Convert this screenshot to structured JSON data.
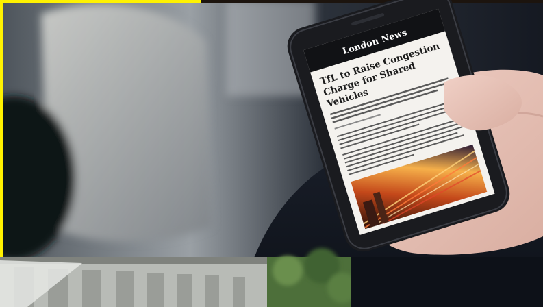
{
  "article": {
    "masthead": "London News",
    "headline_lines": [
      "TfL to Raise Congestion",
      "Charge for Shared",
      "Vehicles"
    ]
  },
  "colors": {
    "frame_yellow": "#FFF200",
    "backdrop_dark": "#0b0f17",
    "seat_gray": "#8b9096",
    "phone_body": "#1a1b1f",
    "screen_paper": "#f4f2ee",
    "ink": "#1c1c1c",
    "skin": "#e9c7bd"
  }
}
